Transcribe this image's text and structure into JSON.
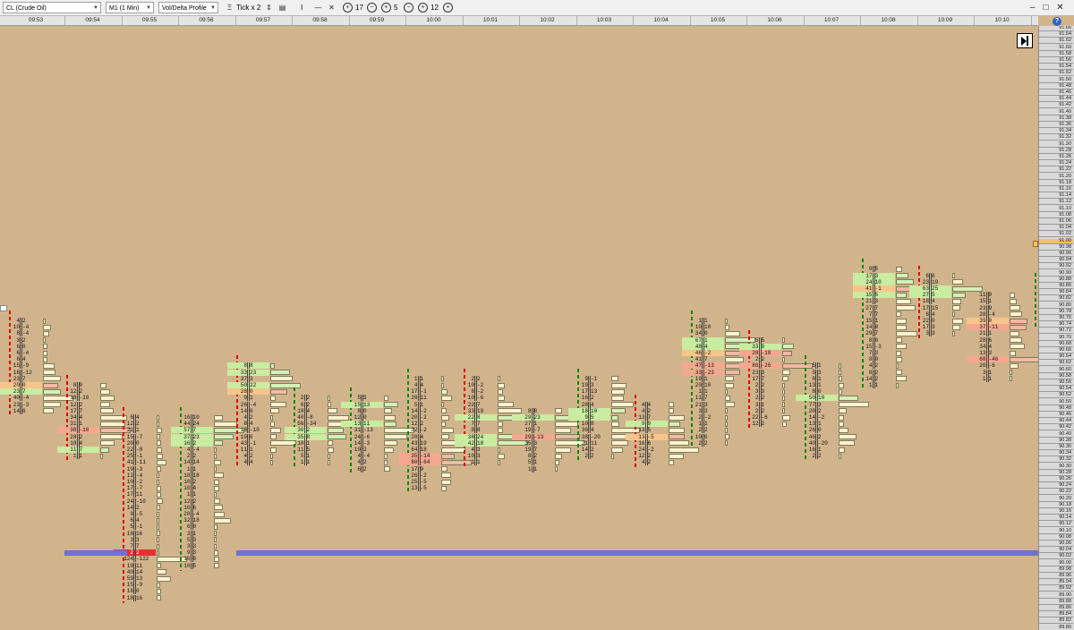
{
  "toolbar": {
    "instrument": "CL (Crude Oil)",
    "timeframe": "M1 (1 Min)",
    "chart_type": "Vol/Delta Profile",
    "tick_label": "Tick x 2",
    "cursor_mode": "I",
    "value_a": "17",
    "value_b": "5",
    "value_c": "12"
  },
  "time_labels": [
    "09:53",
    "09:54",
    "09:55",
    "09:56",
    "09:57",
    "09:58",
    "09:59",
    "10:00",
    "10:01",
    "10:02",
    "10:03",
    "10:04",
    "10:05",
    "10:06",
    "10:07",
    "10:08",
    "10:09",
    "10:10"
  ],
  "price_axis": {
    "top": 91.66,
    "step": 0.02,
    "count": 94,
    "highlight_price": "91.00"
  },
  "colors": {
    "background": "#d2b48c",
    "poc_line": "#6f6fe0",
    "buy_imbalance": "#c8eca0",
    "sell_imbalance": "#f3a88f",
    "max_volume": "#f7c58a",
    "poc_cell": "#e53030",
    "down_bar_marker": "#e00000",
    "up_bar_marker": "#0a8a0a"
  },
  "candles": [
    {
      "time": "09:53",
      "top": 90.76,
      "dir": "down",
      "hl": [
        10,
        11
      ],
      "rows": [
        [
          "4",
          "2"
        ],
        [
          "10",
          "-4"
        ],
        [
          "8",
          "-4"
        ],
        [
          "3",
          "2"
        ],
        [
          "6",
          "0"
        ],
        [
          "6",
          "-4"
        ],
        [
          "6",
          "4"
        ],
        [
          "15",
          "-9"
        ],
        [
          "16",
          "-12"
        ],
        [
          "23",
          "7"
        ],
        [
          "20",
          "0"
        ],
        [
          "23",
          "7"
        ],
        [
          "40",
          "-4"
        ],
        [
          "23",
          "-3"
        ],
        [
          "14",
          "6"
        ]
      ]
    },
    {
      "time": "09:54",
      "top": 90.56,
      "dir": "down",
      "hl": [
        10,
        7
      ],
      "rows": [
        [
          "8",
          "0"
        ],
        [
          "12",
          "2"
        ],
        [
          "18",
          "-10"
        ],
        [
          "12",
          "2"
        ],
        [
          "17",
          "7"
        ],
        [
          "34",
          "4"
        ],
        [
          "31",
          "1"
        ],
        [
          "38",
          "-10"
        ],
        [
          "28",
          "2"
        ],
        [
          "18",
          "4"
        ],
        [
          "11",
          "7"
        ],
        [
          "1",
          "1"
        ]
      ]
    },
    {
      "time": "09:55",
      "top": 90.46,
      "dir": "down",
      "hl": [
        21
      ],
      "poc": 21,
      "rows": [
        [
          "6",
          "4"
        ],
        [
          "12",
          "2"
        ],
        [
          "21",
          "1"
        ],
        [
          "15",
          "-7"
        ],
        [
          "20",
          "0"
        ],
        [
          "22",
          "-8"
        ],
        [
          "25",
          "-1"
        ],
        [
          "41",
          "-11"
        ],
        [
          "19",
          "-3"
        ],
        [
          "12",
          "-4"
        ],
        [
          "10",
          "-2"
        ],
        [
          "17",
          "-7"
        ],
        [
          "17",
          "11"
        ],
        [
          "24",
          "-10"
        ],
        [
          "14",
          "2"
        ],
        [
          "9",
          "-5"
        ],
        [
          "6",
          "4"
        ],
        [
          "5",
          "-1"
        ],
        [
          "16",
          "16"
        ],
        [
          "3",
          "3"
        ],
        [
          "7",
          "7"
        ],
        [
          "2",
          "2"
        ],
        [
          "124",
          "-122"
        ],
        [
          "19",
          "11"
        ],
        [
          "40",
          "14"
        ],
        [
          "59",
          "13"
        ],
        [
          "15",
          "-9"
        ],
        [
          "18",
          "0"
        ],
        [
          "18",
          "16"
        ]
      ]
    },
    {
      "time": "09:56",
      "top": 90.46,
      "dir": "green",
      "hl": [
        2,
        3,
        4
      ],
      "rows": [
        [
          "16",
          "10"
        ],
        [
          "44",
          "24"
        ],
        [
          "57",
          "7"
        ],
        [
          "37",
          "23"
        ],
        [
          "16",
          "2"
        ],
        [
          "4",
          "-4"
        ],
        [
          "2",
          "2"
        ],
        [
          "14",
          "14"
        ],
        [
          "1",
          "1"
        ],
        [
          "18",
          "18"
        ],
        [
          "10",
          "2"
        ],
        [
          "10",
          "4"
        ],
        [
          "1",
          "1"
        ],
        [
          "12",
          "2"
        ],
        [
          "16",
          "6"
        ],
        [
          "20",
          "-4"
        ],
        [
          "32",
          "18"
        ],
        [
          "6",
          "0"
        ],
        [
          "3",
          "1"
        ],
        [
          "5",
          "3"
        ],
        [
          "3",
          "3"
        ],
        [
          "9",
          "3"
        ],
        [
          "10",
          "8"
        ],
        [
          "10",
          "5"
        ]
      ]
    },
    {
      "time": "09:57",
      "top": 90.62,
      "dir": "down",
      "hl": [
        0,
        1,
        3,
        4
      ],
      "rows": [
        [
          "8",
          "8"
        ],
        [
          "33",
          "23"
        ],
        [
          "37",
          "3"
        ],
        [
          "50",
          "22"
        ],
        [
          "28",
          "0"
        ],
        [
          "9",
          "1"
        ],
        [
          "26",
          "-4"
        ],
        [
          "14",
          "6"
        ],
        [
          "4",
          "2"
        ],
        [
          "8",
          "4"
        ],
        [
          "18",
          "-10"
        ],
        [
          "10",
          "6"
        ],
        [
          "43",
          "-1"
        ],
        [
          "11",
          "1"
        ],
        [
          "4",
          "2"
        ],
        [
          "4",
          "4"
        ]
      ]
    },
    {
      "time": "09:58",
      "top": 90.52,
      "dir": "green",
      "hl": [
        5,
        6
      ],
      "rows": [
        [
          "2",
          "2"
        ],
        [
          "6",
          "2"
        ],
        [
          "18",
          "4"
        ],
        [
          "40",
          "-8"
        ],
        [
          "56",
          "-34"
        ],
        [
          "30",
          "2"
        ],
        [
          "35",
          "8"
        ],
        [
          "10",
          "1"
        ],
        [
          "11",
          "5"
        ],
        [
          "5",
          "1"
        ],
        [
          "1",
          "1"
        ]
      ]
    },
    {
      "time": "09:59",
      "top": 90.52,
      "dir": "green",
      "hl": [
        1,
        4
      ],
      "rows": [
        [
          "5",
          "5"
        ],
        [
          "15",
          "13"
        ],
        [
          "8",
          "0"
        ],
        [
          "12",
          "0"
        ],
        [
          "13",
          "11"
        ],
        [
          "31",
          "-13"
        ],
        [
          "24",
          "-6"
        ],
        [
          "14",
          "-3"
        ],
        [
          "10",
          "2"
        ],
        [
          "4",
          "-4"
        ],
        [
          "4",
          "2"
        ],
        [
          "6",
          "2"
        ]
      ]
    },
    {
      "time": "10:00",
      "top": 90.58,
      "dir": "green",
      "hl": [
        12,
        13
      ],
      "rows": [
        [
          "1",
          "1"
        ],
        [
          "4",
          "4"
        ],
        [
          "17",
          "-1"
        ],
        [
          "28",
          "11"
        ],
        [
          "5",
          "1"
        ],
        [
          "14",
          "-2"
        ],
        [
          "20",
          "-2"
        ],
        [
          "12",
          "2"
        ],
        [
          "32",
          "-2"
        ],
        [
          "20",
          "4"
        ],
        [
          "43",
          "19"
        ],
        [
          "64",
          "18"
        ],
        [
          "35",
          "-14"
        ],
        [
          "80",
          "-64"
        ],
        [
          "17",
          "9"
        ],
        [
          "26",
          "-2"
        ],
        [
          "25",
          "-5"
        ],
        [
          "13",
          "-5"
        ]
      ]
    },
    {
      "time": "10:01",
      "top": 90.58,
      "dir": "down",
      "hl": [
        6,
        9,
        10
      ],
      "rows": [
        [
          "2",
          "2"
        ],
        [
          "10",
          "-2"
        ],
        [
          "8",
          "-2"
        ],
        [
          "10",
          "-6"
        ],
        [
          "22",
          "7"
        ],
        [
          "33",
          "19"
        ],
        [
          "22",
          "8"
        ],
        [
          "7",
          "7"
        ],
        [
          "8",
          "8"
        ],
        [
          "38",
          "24"
        ],
        [
          "42",
          "18"
        ],
        [
          "4",
          "3"
        ],
        [
          "10",
          "3"
        ],
        [
          "1",
          "1"
        ]
      ]
    },
    {
      "time": "10:02",
      "top": 90.48,
      "dir": "none",
      "hl": [
        1,
        4
      ],
      "rows": [
        [
          "8",
          "8"
        ],
        [
          "29",
          "23"
        ],
        [
          "27",
          "1"
        ],
        [
          "19",
          "-7"
        ],
        [
          "29",
          "-13"
        ],
        [
          "35",
          "3"
        ],
        [
          "19",
          "7"
        ],
        [
          "8",
          "2"
        ],
        [
          "5",
          "1"
        ],
        [
          "1",
          "1"
        ]
      ]
    },
    {
      "time": "10:03",
      "top": 90.58,
      "dir": "green",
      "hl": [
        5,
        6
      ],
      "rows": [
        [
          "9",
          "-1"
        ],
        [
          "19",
          "3"
        ],
        [
          "17",
          "13"
        ],
        [
          "16",
          "2"
        ],
        [
          "28",
          "4"
        ],
        [
          "18",
          "10"
        ],
        [
          "9",
          "5"
        ],
        [
          "10",
          "8"
        ],
        [
          "36",
          "4"
        ],
        [
          "38",
          "-20"
        ],
        [
          "21",
          "11"
        ],
        [
          "14",
          "2"
        ],
        [
          "2",
          "2"
        ]
      ]
    },
    {
      "time": "10:04",
      "top": 90.5,
      "dir": "down",
      "hl": [
        3,
        5
      ],
      "rows": [
        [
          "4",
          "4"
        ],
        [
          "4",
          "2"
        ],
        [
          "13",
          "7"
        ],
        [
          "9",
          "9"
        ],
        [
          "13",
          "5"
        ],
        [
          "13",
          "-5"
        ],
        [
          "16",
          "6"
        ],
        [
          "24",
          "-2"
        ],
        [
          "12",
          "2"
        ],
        [
          "4",
          "2"
        ]
      ]
    },
    {
      "time": "10:05",
      "top": 90.76,
      "dir": "green",
      "hl": [
        3,
        4,
        5,
        7,
        8
      ],
      "rows": [
        [
          "1",
          "1"
        ],
        [
          "10",
          "10"
        ],
        [
          "34",
          "0"
        ],
        [
          "67",
          "1"
        ],
        [
          "48",
          "4"
        ],
        [
          "46",
          "-2"
        ],
        [
          "41",
          "7"
        ],
        [
          "47",
          "-13"
        ],
        [
          "33",
          "-23"
        ],
        [
          "19",
          "1"
        ],
        [
          "20",
          "10"
        ],
        [
          "1",
          "1"
        ],
        [
          "11",
          "7"
        ],
        [
          "21",
          "3"
        ],
        [
          "3",
          "3"
        ],
        [
          "2",
          "-2"
        ],
        [
          "1",
          "1"
        ],
        [
          "2",
          "2"
        ],
        [
          "10",
          "6"
        ],
        [
          "2",
          "2"
        ]
      ]
    },
    {
      "time": "10:06",
      "top": 90.7,
      "dir": "down",
      "hl": [
        1,
        2,
        4
      ],
      "rows": [
        [
          "5",
          "5"
        ],
        [
          "33",
          "9"
        ],
        [
          "28",
          "-18"
        ],
        [
          "2",
          "2"
        ],
        [
          "86",
          "-26"
        ],
        [
          "23",
          "3"
        ],
        [
          "17",
          "7"
        ],
        [
          "2",
          "2"
        ],
        [
          "3",
          "3"
        ],
        [
          "2",
          "2"
        ],
        [
          "3",
          "1"
        ],
        [
          "2",
          "2"
        ],
        [
          "22",
          "-6"
        ],
        [
          "12",
          "2"
        ]
      ]
    },
    {
      "time": "10:07",
      "top": 90.62,
      "dir": "green",
      "hl": [
        5
      ],
      "rows": [
        [
          "5",
          "1"
        ],
        [
          "5",
          "3"
        ],
        [
          "8",
          "1"
        ],
        [
          "13",
          "1"
        ],
        [
          "8",
          "0"
        ],
        [
          "50",
          "10"
        ],
        [
          "77",
          "3"
        ],
        [
          "20",
          "2"
        ],
        [
          "14",
          "-2"
        ],
        [
          "13",
          "1"
        ],
        [
          "26",
          "0"
        ],
        [
          "46",
          "2"
        ],
        [
          "40",
          "-20"
        ],
        [
          "16",
          "1"
        ],
        [
          "2",
          "2"
        ]
      ]
    },
    {
      "time": "10:08",
      "top": 90.92,
      "dir": "green",
      "hl": [
        1,
        2,
        3,
        4
      ],
      "rows": [
        [
          "9",
          "5"
        ],
        [
          "17",
          "3"
        ],
        [
          "24",
          "10"
        ],
        [
          "41",
          "-1"
        ],
        [
          "15",
          "5"
        ],
        [
          "21",
          "3"
        ],
        [
          "27",
          "7"
        ],
        [
          "7",
          "7"
        ],
        [
          "15",
          "1"
        ],
        [
          "14",
          "8"
        ],
        [
          "29",
          "7"
        ],
        [
          "8",
          "0"
        ],
        [
          "15",
          "-3"
        ],
        [
          "7",
          "3"
        ],
        [
          "8",
          "0"
        ],
        [
          "4",
          "2"
        ],
        [
          "8",
          "2"
        ],
        [
          "14",
          "2"
        ],
        [
          "1",
          "1"
        ]
      ]
    },
    {
      "time": "10:09",
      "top": 90.9,
      "dir": "down",
      "hl": [
        2,
        3
      ],
      "rows": [
        [
          "6",
          "6"
        ],
        [
          "23",
          "19"
        ],
        [
          "63",
          "25"
        ],
        [
          "27",
          "5"
        ],
        [
          "18",
          "4"
        ],
        [
          "17",
          "15"
        ],
        [
          "6",
          "4"
        ],
        [
          "22",
          "0"
        ],
        [
          "17",
          "3"
        ],
        [
          "3",
          "3"
        ]
      ]
    },
    {
      "time": "10:10",
      "top": 90.84,
      "dir": "none",
      "hl": [
        4,
        5,
        10
      ],
      "rows": [
        [
          "11",
          "9"
        ],
        [
          "15",
          "1"
        ],
        [
          "23",
          "9"
        ],
        [
          "28",
          "-4"
        ],
        [
          "39",
          "0"
        ],
        [
          "37",
          "-11"
        ],
        [
          "21",
          "1"
        ],
        [
          "28",
          "6"
        ],
        [
          "34",
          "4"
        ],
        [
          "13",
          "3"
        ],
        [
          "68",
          "-46"
        ],
        [
          "20",
          "-6"
        ],
        [
          "3",
          "1"
        ],
        [
          "1",
          "1"
        ]
      ]
    }
  ]
}
